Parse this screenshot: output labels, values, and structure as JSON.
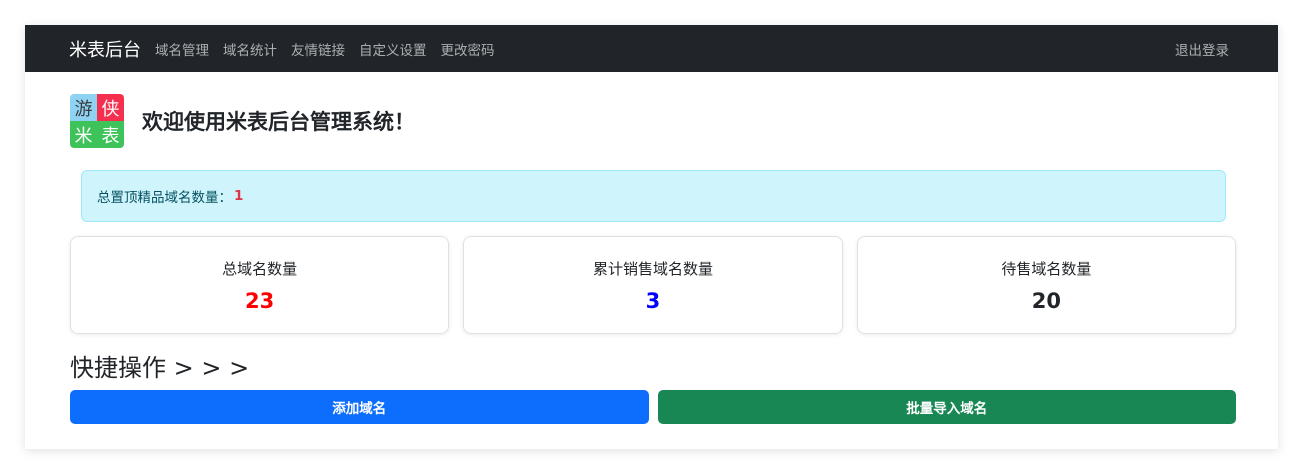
{
  "navbar": {
    "brand": "米表后台",
    "links": [
      "域名管理",
      "域名统计",
      "友情链接",
      "自定义设置",
      "更改密码"
    ],
    "logout": "退出登录"
  },
  "header": {
    "logo_chars": [
      "游",
      "侠",
      "米",
      "表"
    ],
    "welcome": "欢迎使用米表后台管理系统！"
  },
  "alert": {
    "label": "总置顶精品域名数量：",
    "count": "1"
  },
  "stats": [
    {
      "title": "总域名数量",
      "value": "23",
      "color": "#ff0000"
    },
    {
      "title": "累计销售域名数量",
      "value": "3",
      "color": "#0000ff"
    },
    {
      "title": "待售域名数量",
      "value": "20",
      "color": "#212529"
    }
  ],
  "quick": {
    "title": "快捷操作 > > >",
    "add_label": "添加域名",
    "import_label": "批量导入域名"
  },
  "colors": {
    "navbar_bg": "#212529",
    "primary": "#0d6efd",
    "success": "#198754",
    "alert_bg": "#cff4fc"
  }
}
